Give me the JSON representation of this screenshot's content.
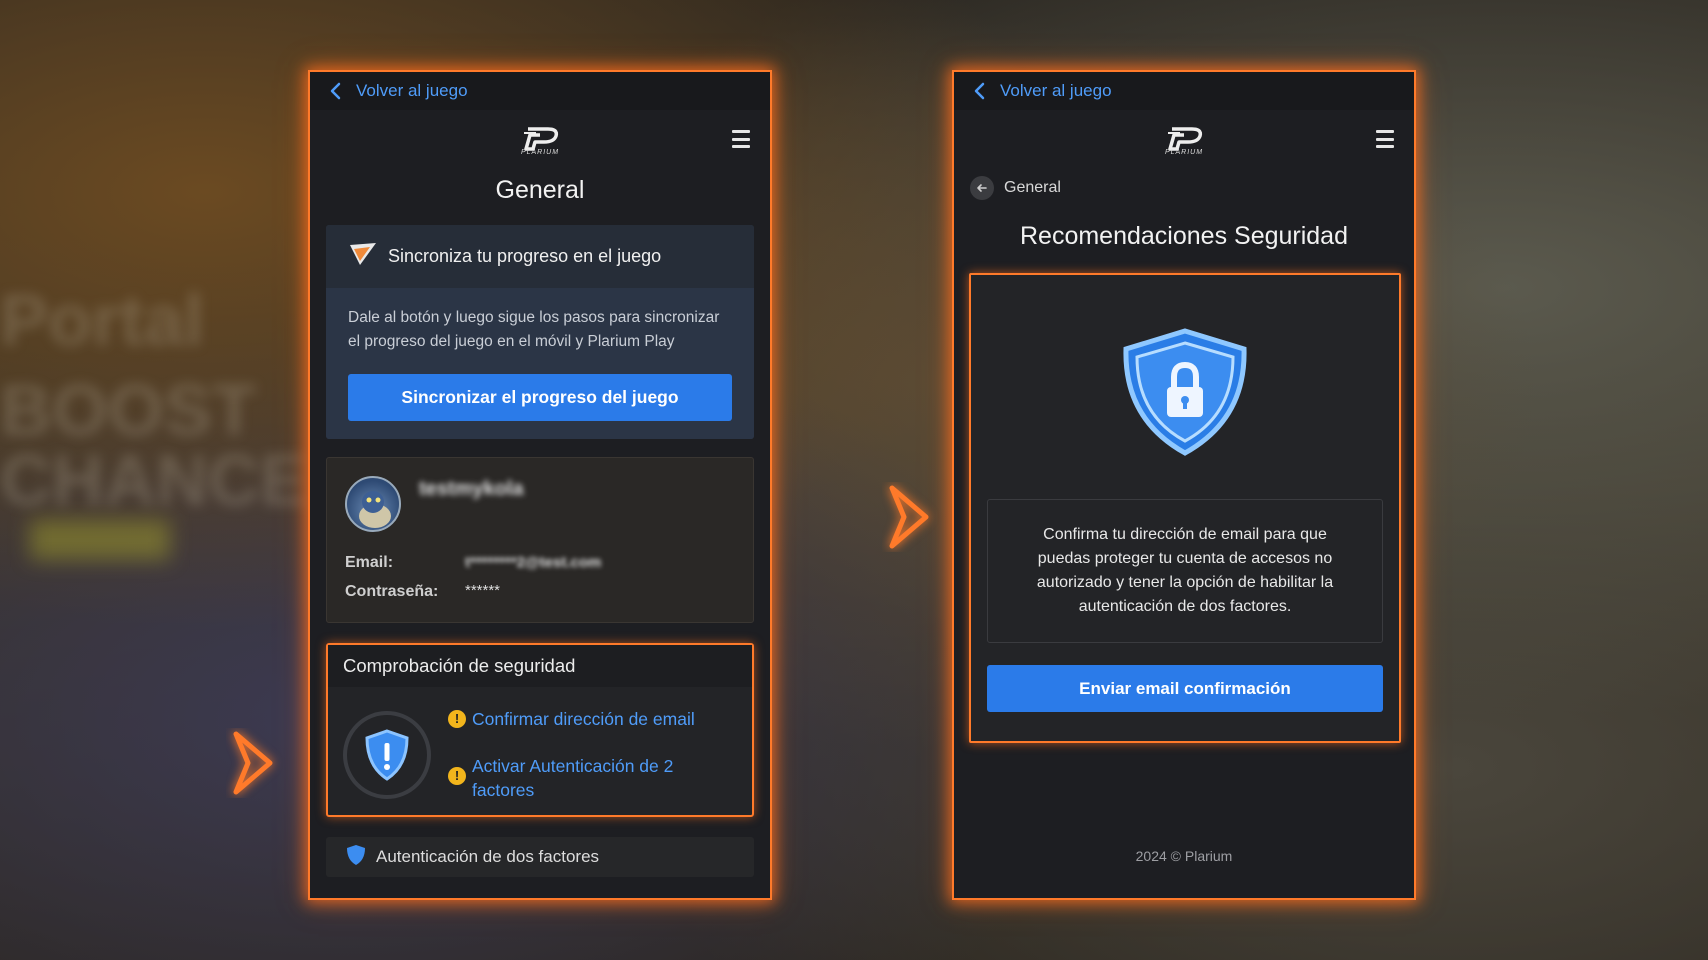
{
  "left_panel": {
    "back_label": "Volver al juego",
    "logo_text": "PLARIUM",
    "title": "General",
    "sync": {
      "heading": "Sincroniza tu progreso en el juego",
      "description": "Dale al botón y luego sigue los pasos para sincronizar el progreso del juego en el móvil y Plarium Play",
      "button_label": "Sincronizar el progreso del juego"
    },
    "account": {
      "username": "testmykola",
      "email_label": "Email:",
      "email_value": "t********2@test.com",
      "password_label": "Contraseña:",
      "password_value": "******"
    },
    "security": {
      "heading": "Comprobación de seguridad",
      "items": [
        {
          "label": "Confirmar dirección de email",
          "icon": "warning-icon"
        },
        {
          "label": "Activar Autenticación de 2 factores",
          "icon": "warning-icon"
        }
      ]
    },
    "next_section_peek": "Autenticación de dos factores"
  },
  "right_panel": {
    "back_label": "Volver al juego",
    "logo_text": "PLARIUM",
    "breadcrumb": "General",
    "title": "Recomendaciones Seguridad",
    "message": "Confirma tu dirección de email para que puedas proteger tu cuenta de accesos no autorizado y tener la opción de habilitar la autenticación de dos factores.",
    "button_label": "Enviar email confirmación",
    "footer": "2024 © Plarium"
  },
  "colors": {
    "accent_blue": "#2b7be9",
    "link_blue": "#4f9cf9",
    "highlight_orange": "#ff7a2a",
    "warning_yellow": "#f2b51c"
  }
}
